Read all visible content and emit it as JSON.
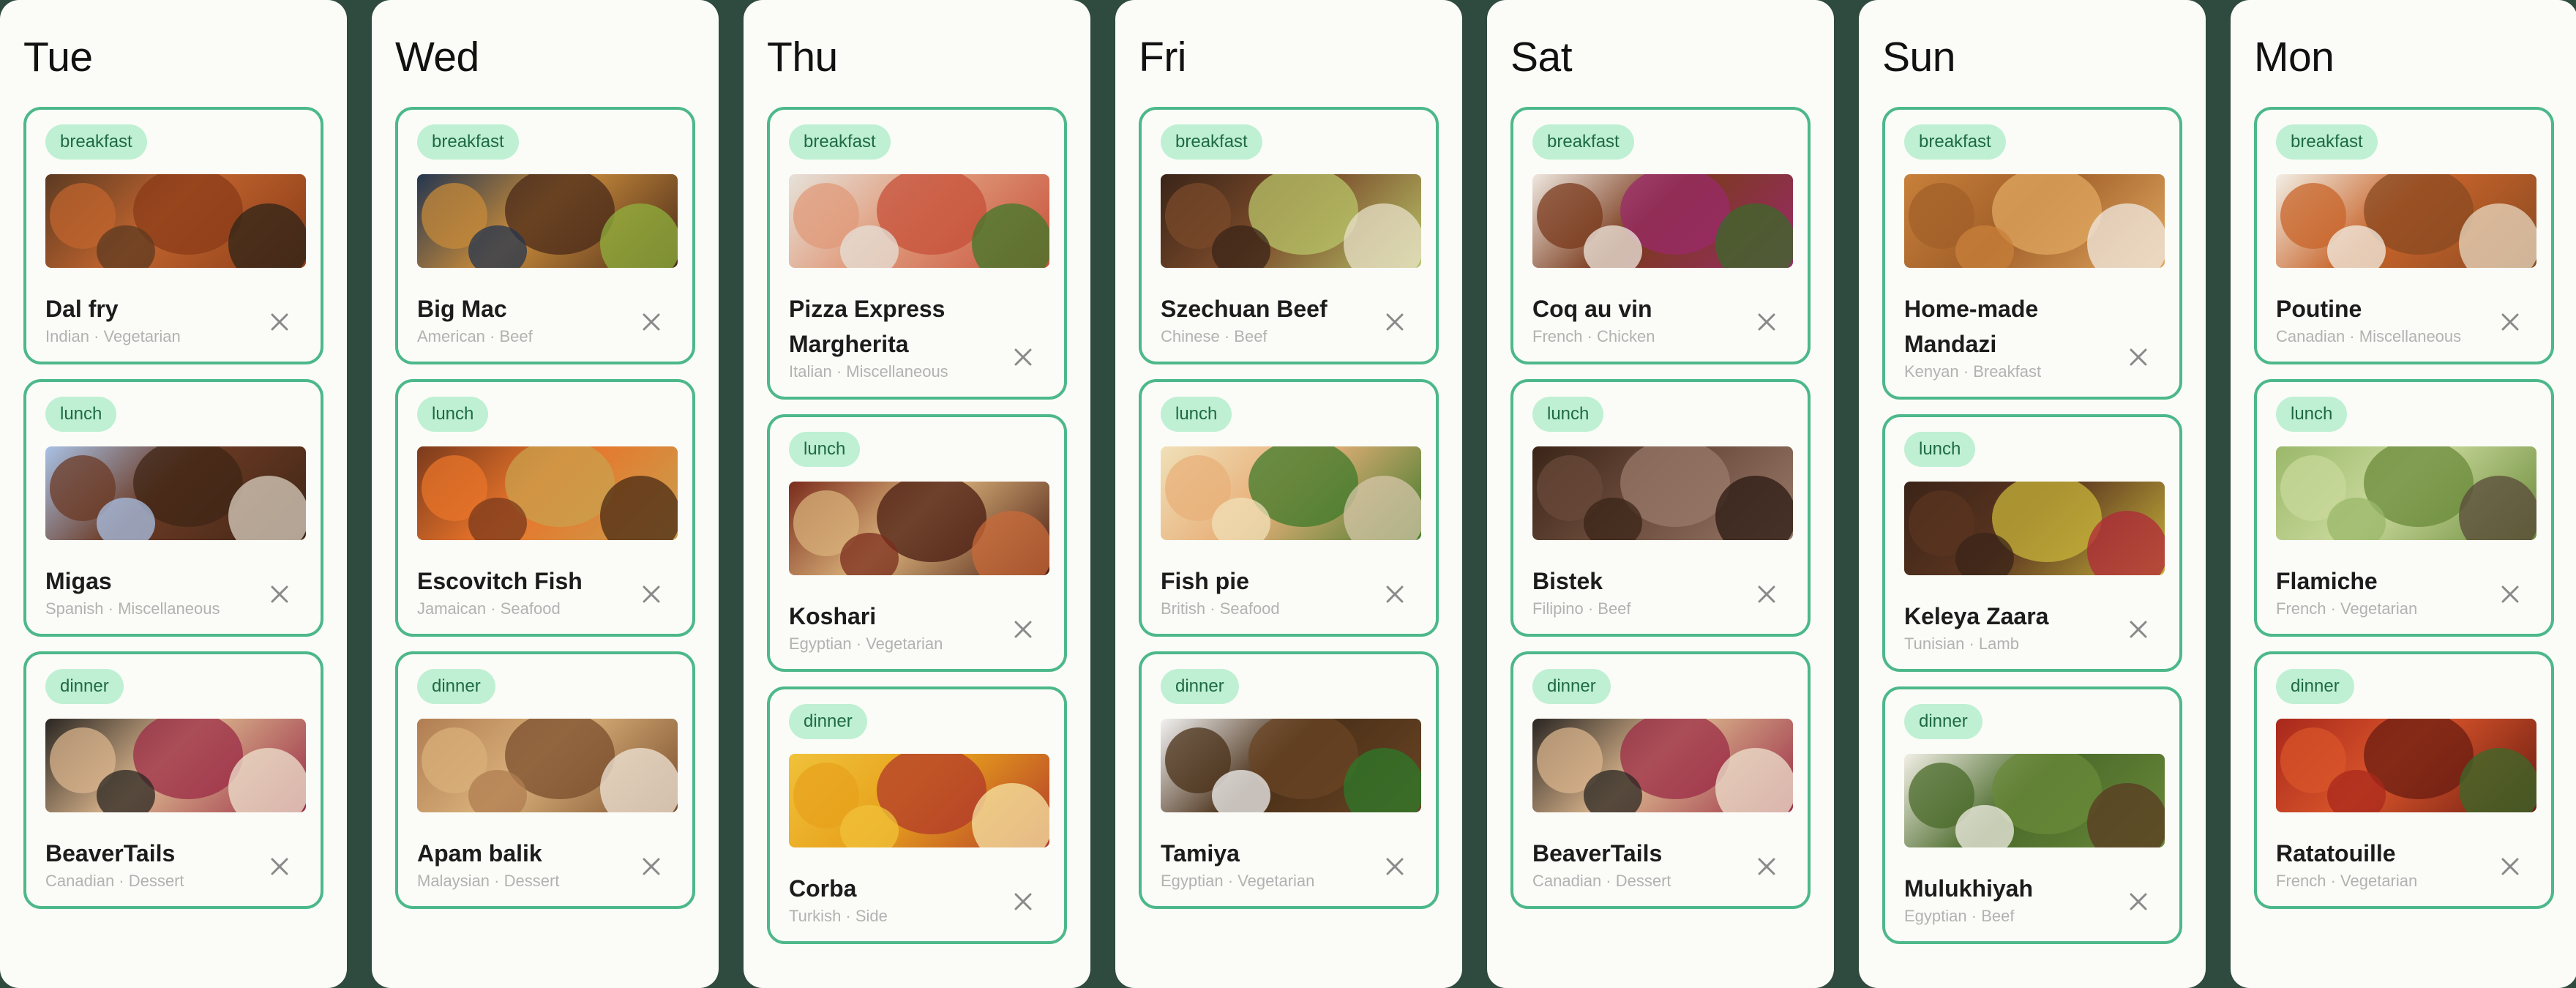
{
  "days": [
    {
      "name": "Tue",
      "meals": [
        {
          "tag": "breakfast",
          "name": "Dal fry",
          "cuisine": "Indian",
          "category": "Vegetarian",
          "photo": "dal-fry-photo",
          "colors": [
            "#5b3a22",
            "#c0642e",
            "#8a3b18",
            "#2e2418"
          ]
        },
        {
          "tag": "lunch",
          "name": "Migas",
          "cuisine": "Spanish",
          "category": "Miscellaneous",
          "photo": "migas-photo",
          "colors": [
            "#a9c2e6",
            "#6b3a24",
            "#3f2616",
            "#d9cfc0"
          ]
        },
        {
          "tag": "dinner",
          "name": "BeaverTails",
          "cuisine": "Canadian",
          "category": "Dessert",
          "photo": "beavertails-photo",
          "colors": [
            "#2a2622",
            "#d9b48c",
            "#9b2b46",
            "#efe3cf"
          ]
        }
      ]
    },
    {
      "name": "Wed",
      "meals": [
        {
          "tag": "breakfast",
          "name": "Big Mac",
          "cuisine": "American",
          "category": "Beef",
          "photo": "big-mac-photo",
          "colors": [
            "#243650",
            "#c68a3a",
            "#4a2a1a",
            "#8fb03c"
          ]
        },
        {
          "tag": "lunch",
          "name": "Escovitch Fish",
          "cuisine": "Jamaican",
          "category": "Seafood",
          "photo": "escovitch-fish-photo",
          "colors": [
            "#7a3a1c",
            "#e8742a",
            "#c9a04e",
            "#4a2a14"
          ]
        },
        {
          "tag": "dinner",
          "name": "Apam balik",
          "cuisine": "Malaysian",
          "category": "Dessert",
          "photo": "apam-balik-photo",
          "colors": [
            "#b07d52",
            "#d9b07a",
            "#7a4e2c",
            "#f0e6d8"
          ]
        }
      ]
    },
    {
      "name": "Thu",
      "meals": [
        {
          "tag": "breakfast",
          "name": "Pizza Express Margherita",
          "cuisine": "Italian",
          "category": "Miscellaneous",
          "photo": "margherita-photo",
          "colors": [
            "#e6e2da",
            "#e09a7a",
            "#c6503a",
            "#3f7a2a"
          ]
        },
        {
          "tag": "lunch",
          "name": "Koshari",
          "cuisine": "Egyptian",
          "category": "Vegetarian",
          "photo": "koshari-photo",
          "colors": [
            "#7a2c1c",
            "#d8b079",
            "#4a1c12",
            "#c86a3a"
          ]
        },
        {
          "tag": "dinner",
          "name": "Corba",
          "cuisine": "Turkish",
          "category": "Side",
          "photo": "corba-photo",
          "colors": [
            "#f0c23a",
            "#e8a21c",
            "#b23a2a",
            "#f7e6a6"
          ]
        }
      ]
    },
    {
      "name": "Fri",
      "meals": [
        {
          "tag": "breakfast",
          "name": "Szechuan Beef",
          "cuisine": "Chinese",
          "category": "Beef",
          "photo": "szechuan-beef-photo",
          "colors": [
            "#3a2418",
            "#7a4a2a",
            "#b8c468",
            "#e8e0c8"
          ]
        },
        {
          "tag": "lunch",
          "name": "Fish pie",
          "cuisine": "British",
          "category": "Seafood",
          "photo": "fish-pie-photo",
          "colors": [
            "#f0e0b8",
            "#e8b07a",
            "#3e7a2a",
            "#d6c6a8"
          ]
        },
        {
          "tag": "dinner",
          "name": "Tamiya",
          "cuisine": "Egyptian",
          "category": "Vegetarian",
          "photo": "tamiya-photo",
          "colors": [
            "#f2f2f2",
            "#4a3018",
            "#6a4424",
            "#2c7a2a"
          ]
        }
      ]
    },
    {
      "name": "Sat",
      "meals": [
        {
          "tag": "breakfast",
          "name": "Coq au vin",
          "cuisine": "French",
          "category": "Chicken",
          "photo": "coq-au-vin-photo",
          "colors": [
            "#efe8e0",
            "#7a3a1c",
            "#9a2a6a",
            "#3a6a2a"
          ]
        },
        {
          "tag": "lunch",
          "name": "Bistek",
          "cuisine": "Filipino",
          "category": "Beef",
          "photo": "bistek-photo",
          "colors": [
            "#3a2418",
            "#6a4a3a",
            "#9a7a6a",
            "#2a1a12"
          ]
        },
        {
          "tag": "dinner",
          "name": "BeaverTails",
          "cuisine": "Canadian",
          "category": "Dessert",
          "photo": "beavertails-photo",
          "colors": [
            "#2a2622",
            "#d9b48c",
            "#9b2b46",
            "#efe3cf"
          ]
        }
      ]
    },
    {
      "name": "Sun",
      "meals": [
        {
          "tag": "breakfast",
          "name": "Home-made Mandazi",
          "cuisine": "Kenyan",
          "category": "Breakfast",
          "photo": "mandazi-photo",
          "colors": [
            "#c8803a",
            "#a2602a",
            "#e0a860",
            "#f0e8e0"
          ]
        },
        {
          "tag": "lunch",
          "name": "Keleya Zaara",
          "cuisine": "Tunisian",
          "category": "Lamb",
          "photo": "keleya-zaara-photo",
          "colors": [
            "#3a2418",
            "#5a3420",
            "#c8b43a",
            "#b0283a"
          ]
        },
        {
          "tag": "dinner",
          "name": "Mulukhiyah",
          "cuisine": "Egyptian",
          "category": "Beef",
          "photo": "mulukhiyah-photo",
          "colors": [
            "#f2efe6",
            "#4a6a2a",
            "#6a8a3a",
            "#5a3a22"
          ]
        }
      ]
    },
    {
      "name": "Mon",
      "meals": [
        {
          "tag": "breakfast",
          "name": "Poutine",
          "cuisine": "Canadian",
          "category": "Miscellaneous",
          "photo": "poutine-photo",
          "colors": [
            "#f2efe6",
            "#c8642a",
            "#8a4a22",
            "#e8d8c0"
          ]
        },
        {
          "tag": "lunch",
          "name": "Flamiche",
          "cuisine": "French",
          "category": "Vegetarian",
          "photo": "flamiche-photo",
          "colors": [
            "#9ab86a",
            "#c8d89a",
            "#6a8a3a",
            "#5a4a3a"
          ]
        },
        {
          "tag": "dinner",
          "name": "Ratatouille",
          "cuisine": "French",
          "category": "Vegetarian",
          "photo": "ratatouille-photo",
          "colors": [
            "#a8281c",
            "#d8542a",
            "#6a1c12",
            "#3a6a2a"
          ]
        }
      ]
    }
  ]
}
